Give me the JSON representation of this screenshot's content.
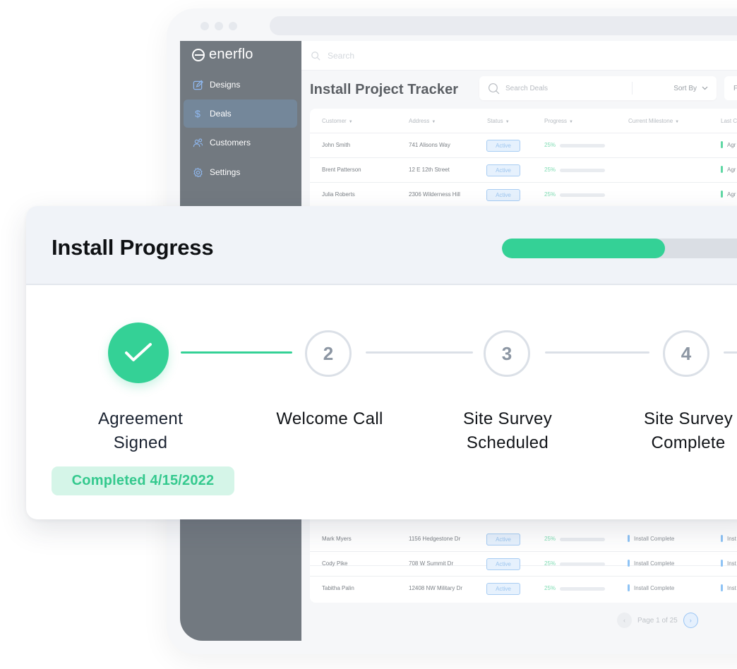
{
  "app": {
    "brand": "enerflo",
    "top_search_placeholder": "Search"
  },
  "sidebar": {
    "items": [
      {
        "label": "Designs",
        "icon": "pencil-square-icon",
        "active": false
      },
      {
        "label": "Deals",
        "icon": "dollar-icon",
        "active": true
      },
      {
        "label": "Customers",
        "icon": "users-icon",
        "active": false
      },
      {
        "label": "Settings",
        "icon": "gear-icon",
        "active": false
      }
    ]
  },
  "tracker": {
    "title": "Install Project Tracker",
    "search_placeholder": "Search Deals",
    "sort_label": "Sort By",
    "filter_label": "F",
    "columns": [
      "Customer",
      "Address",
      "Status",
      "Progress",
      "Current Milestone",
      "Last C"
    ],
    "rows": [
      {
        "customer": "John Smith",
        "address": "741 Alisons Way",
        "status": "Active",
        "progress_pct": 25,
        "progress_label": "25%",
        "milestone": "",
        "last": "Agr",
        "last_color": "#5fd7a4"
      },
      {
        "customer": "Brent Patterson",
        "address": "12 E 12th Street",
        "status": "Active",
        "progress_pct": 25,
        "progress_label": "25%",
        "milestone": "",
        "last": "Agr",
        "last_color": "#5fd7a4"
      },
      {
        "customer": "Julia Roberts",
        "address": "2306 Wilderness Hill",
        "status": "Active",
        "progress_pct": 25,
        "progress_label": "25%",
        "milestone": "",
        "last": "Agr",
        "last_color": "#5fd7a4"
      },
      {
        "customer": "Mark Myers",
        "address": "1156 Hedgestone Dr",
        "status": "Active",
        "progress_pct": 25,
        "progress_label": "25%",
        "milestone": "Install Complete",
        "last": "Inst",
        "last_color": "#8ec3f5"
      },
      {
        "customer": "Cody Pike",
        "address": "708 W Summit Dr",
        "status": "Active",
        "progress_pct": 25,
        "progress_label": "25%",
        "milestone": "Install Complete",
        "last": "Inst",
        "last_color": "#8ec3f5"
      },
      {
        "customer": "Tabitha Palin",
        "address": "12408 NW Military Dr",
        "status": "Active",
        "progress_pct": 25,
        "progress_label": "25%",
        "milestone": "Install Complete",
        "last": "Inst",
        "last_color": "#8ec3f5"
      }
    ],
    "pagination": {
      "label": "Page 1 of 25",
      "prev": "‹",
      "next": "›"
    }
  },
  "install_progress": {
    "title": "Install Progress",
    "progress_fraction": 0.55,
    "steps": [
      {
        "number": "1",
        "line1": "Agreement",
        "line2": "Signed",
        "status": "done"
      },
      {
        "number": "2",
        "line1": "Welcome Call",
        "line2": "",
        "status": "todo"
      },
      {
        "number": "3",
        "line1": "Site Survey",
        "line2": "Scheduled",
        "status": "todo"
      },
      {
        "number": "4",
        "line1": "Site Survey",
        "line2": "Complete",
        "status": "todo"
      }
    ],
    "completed_badge": "Completed 4/15/2022"
  },
  "colors": {
    "accent_green": "#34d196",
    "sidebar_bg": "#727980",
    "active_nav": "#74879a",
    "status_blue": "#9cc5ef"
  }
}
